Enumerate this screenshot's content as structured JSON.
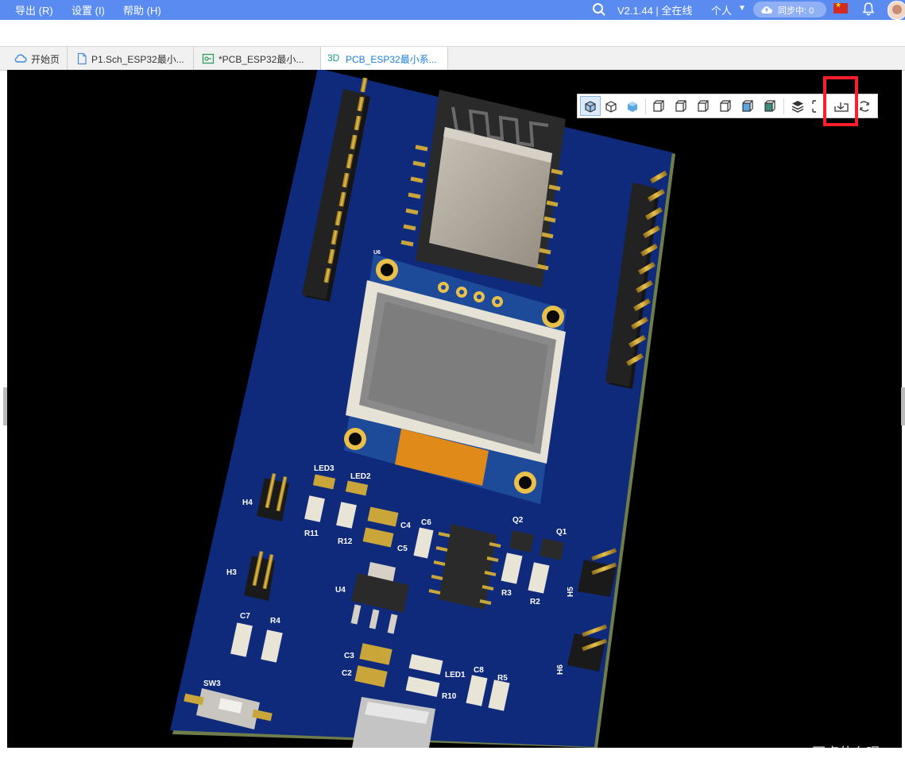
{
  "menubar": {
    "items": [
      "导出 (R)",
      "设置 (I)",
      "帮助 (H)"
    ],
    "version_status": "V2.1.44 | 全在线",
    "profile": "个人",
    "sync": "同步中: 0"
  },
  "tabs": [
    {
      "label": "开始页",
      "icon": "cloud-home-icon"
    },
    {
      "label": "P1.Sch_ESP32最小...",
      "icon": "document-icon"
    },
    {
      "label": "*PCB_ESP32最小...",
      "icon": "pcb-icon"
    },
    {
      "prefix": "3D",
      "label": "PCB_ESP32最小系...",
      "icon": "3d-text-icon",
      "active": true
    }
  ],
  "board": {
    "designators": [
      "LED3",
      "LED2",
      "H4",
      "R11",
      "R12",
      "C4",
      "C6",
      "C5",
      "Q2",
      "Q1",
      "H3",
      "U4",
      "R3",
      "R2",
      "H5",
      "C7",
      "R4",
      "C3",
      "C2",
      "LED1",
      "C8",
      "R5",
      "R10",
      "H6",
      "SW3",
      "U6"
    ]
  },
  "view_toolbar": {
    "buttons": [
      "view-iso-solid",
      "view-iso-wire",
      "view-iso-shaded",
      "view-front",
      "view-back",
      "view-left",
      "view-right",
      "view-top",
      "view-bottom",
      "layers",
      "fit-screen",
      "export-view",
      "rotate"
    ],
    "highlighted": "export-view"
  },
  "colors": {
    "menubar": "#5a8bf0",
    "board": "#0f2a7a",
    "accent_tab": "#1a7edb",
    "highlight": "#ff1f2c"
  },
  "watermark": "CSDN @写点什么呢"
}
